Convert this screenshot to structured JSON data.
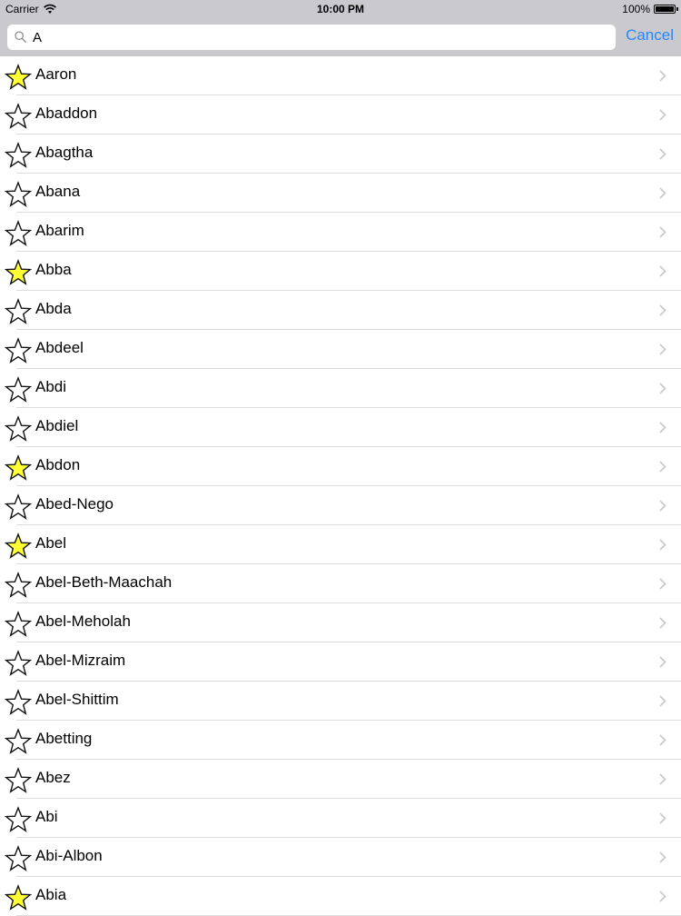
{
  "status_bar": {
    "carrier": "Carrier",
    "time": "10:00 PM",
    "battery": "100%",
    "battery_level": 1.0
  },
  "search": {
    "value": "A",
    "placeholder": "Search",
    "cancel_label": "Cancel"
  },
  "colors": {
    "accent": "#2b86f5",
    "star_favorite": "#ffff33",
    "star_empty": "#ffffff",
    "header_bg": "#c9c9ce"
  },
  "names": [
    {
      "label": "Aaron",
      "favorite": true
    },
    {
      "label": "Abaddon",
      "favorite": false
    },
    {
      "label": "Abagtha",
      "favorite": false
    },
    {
      "label": "Abana",
      "favorite": false
    },
    {
      "label": "Abarim",
      "favorite": false
    },
    {
      "label": "Abba",
      "favorite": true
    },
    {
      "label": "Abda",
      "favorite": false
    },
    {
      "label": "Abdeel",
      "favorite": false
    },
    {
      "label": "Abdi",
      "favorite": false
    },
    {
      "label": "Abdiel",
      "favorite": false
    },
    {
      "label": "Abdon",
      "favorite": true
    },
    {
      "label": "Abed-Nego",
      "favorite": false
    },
    {
      "label": "Abel",
      "favorite": true
    },
    {
      "label": "Abel-Beth-Maachah",
      "favorite": false
    },
    {
      "label": "Abel-Meholah",
      "favorite": false
    },
    {
      "label": "Abel-Mizraim",
      "favorite": false
    },
    {
      "label": "Abel-Shittim",
      "favorite": false
    },
    {
      "label": "Abetting",
      "favorite": false
    },
    {
      "label": "Abez",
      "favorite": false
    },
    {
      "label": "Abi",
      "favorite": false
    },
    {
      "label": "Abi-Albon",
      "favorite": false
    },
    {
      "label": "Abia",
      "favorite": true
    }
  ]
}
